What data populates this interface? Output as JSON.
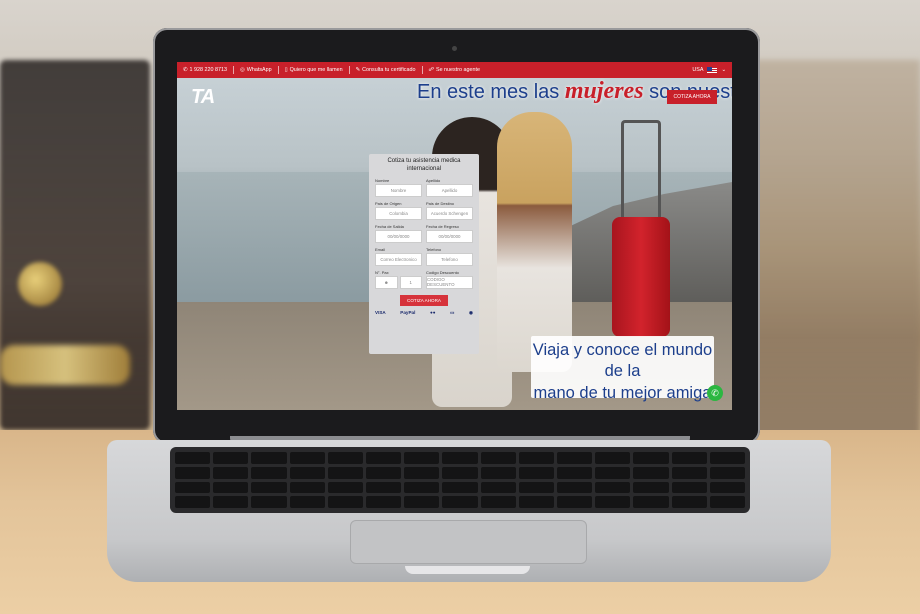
{
  "topbar": {
    "phone": "1 928 220 8713",
    "whatsapp": "WhatsApp",
    "callback": "Quiero que me llamen",
    "certificate": "Consulta tu certificado",
    "agent": "Se nuestro agente",
    "country": "USA"
  },
  "brand": {
    "logo": "TA"
  },
  "hero": {
    "headline_pre": "En este mes las",
    "headline_em": "mujeres",
    "headline_post": "son nuestras consentidas",
    "cta": "COTIZA AHORA",
    "slogan_line1": "Viaja y conoce el mundo de la",
    "slogan_line2": "mano de tu mejor amiga"
  },
  "form": {
    "title": "Cotiza tu asistencia medica internacional",
    "nombre_label": "Nombre",
    "nombre_ph": "Nombre",
    "apellido_label": "Apellido",
    "apellido_ph": "Apellido",
    "origen_label": "Pais de Origen",
    "origen_val": "Colombia",
    "destino_label": "Pais de Destino",
    "destino_val": "Acuerdo Schengen",
    "salida_label": "Fecha de Salida",
    "salida_val": "00/00/0000",
    "regreso_label": "Fecha de Regreso",
    "regreso_val": "00/00/0000",
    "email_label": "Email",
    "email_ph": "Correo Electronico",
    "telefono_label": "Telefono",
    "telefono_ph": "Telefono",
    "pax_label": "N°. Pax",
    "pax_val": "1",
    "descuento_label": "Codigo Descuento",
    "descuento_ph": "CODIGO DESCUENTO",
    "submit": "COTIZA AHORA",
    "payments": [
      "VISA",
      "PayPal"
    ]
  },
  "colors": {
    "brand_red": "#c8202a",
    "brand_blue": "#1d3f8c"
  },
  "icons": [
    "phone-icon",
    "whatsapp-icon",
    "mobile-icon",
    "edit-icon",
    "handshake-icon",
    "flag-usa-icon",
    "chevron-down-icon"
  ]
}
